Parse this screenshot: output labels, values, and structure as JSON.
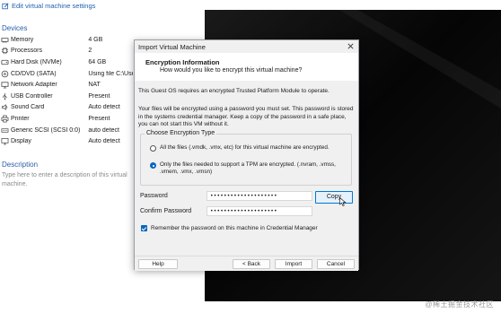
{
  "settings_link": {
    "label": "Edit virtual machine settings",
    "icon": "edit-settings-icon"
  },
  "devices": {
    "title": "Devices",
    "items": [
      {
        "name": "Memory",
        "value": "4 GB",
        "icon": "memory-icon"
      },
      {
        "name": "Processors",
        "value": "2",
        "icon": "processor-icon"
      },
      {
        "name": "Hard Disk (NVMe)",
        "value": "64 GB",
        "icon": "hard-disk-icon"
      },
      {
        "name": "CD/DVD (SATA)",
        "value": "Using file C:\\Use",
        "icon": "cd-dvd-icon"
      },
      {
        "name": "Network Adapter",
        "value": "NAT",
        "icon": "network-adapter-icon"
      },
      {
        "name": "USB Controller",
        "value": "Present",
        "icon": "usb-icon"
      },
      {
        "name": "Sound Card",
        "value": "Auto detect",
        "icon": "sound-card-icon"
      },
      {
        "name": "Printer",
        "value": "Present",
        "icon": "printer-icon"
      },
      {
        "name": "Generic SCSI (SCSI 0:0)",
        "value": "auto detect",
        "icon": "scsi-icon"
      },
      {
        "name": "Display",
        "value": "Auto detect",
        "icon": "display-icon"
      }
    ]
  },
  "description": {
    "title": "Description",
    "placeholder": "Type here to enter a description of this virtual machine."
  },
  "dialog": {
    "title": "Import Virtual Machine",
    "header_title": "Encryption Information",
    "header_subtitle": "How would you like to encrypt this virtual machine?",
    "intro": "This Guest OS requires an encrypted Trusted Platform Module to operate.",
    "explanation": "Your files will be encrypted using a password you must set. This password is stored in the systems credential manager. Keep a copy of the password in a safe place, you can not start this VM without it.",
    "group_label": "Choose Encryption Type",
    "options": [
      {
        "label": "All the files (.vmdk, .vmx, etc) for this virtual machine are encrypted.",
        "selected": false
      },
      {
        "label": "Only the files needed to support a TPM are encrypted. (.nvram, .vmss, .vmem, .vmx, .vmsn)",
        "selected": true
      }
    ],
    "password_label": "Password",
    "password_value": "••••••••••••••••••••",
    "confirm_label": "Confirm Password",
    "confirm_value": "••••••••••••••••••••",
    "copy_label": "Copy",
    "remember_label": "Remember the password on this machine in Credential Manager",
    "remember_checked": true,
    "buttons": {
      "help": "Help",
      "back": "< Back",
      "import": "Import",
      "cancel": "Cancel"
    }
  },
  "watermark": "@稀土掘金技术社区",
  "colors": {
    "accent": "#0067c0",
    "link": "#1f5fb0",
    "section_title": "#2a5ea8",
    "vm_background": "#0d0d0d"
  }
}
